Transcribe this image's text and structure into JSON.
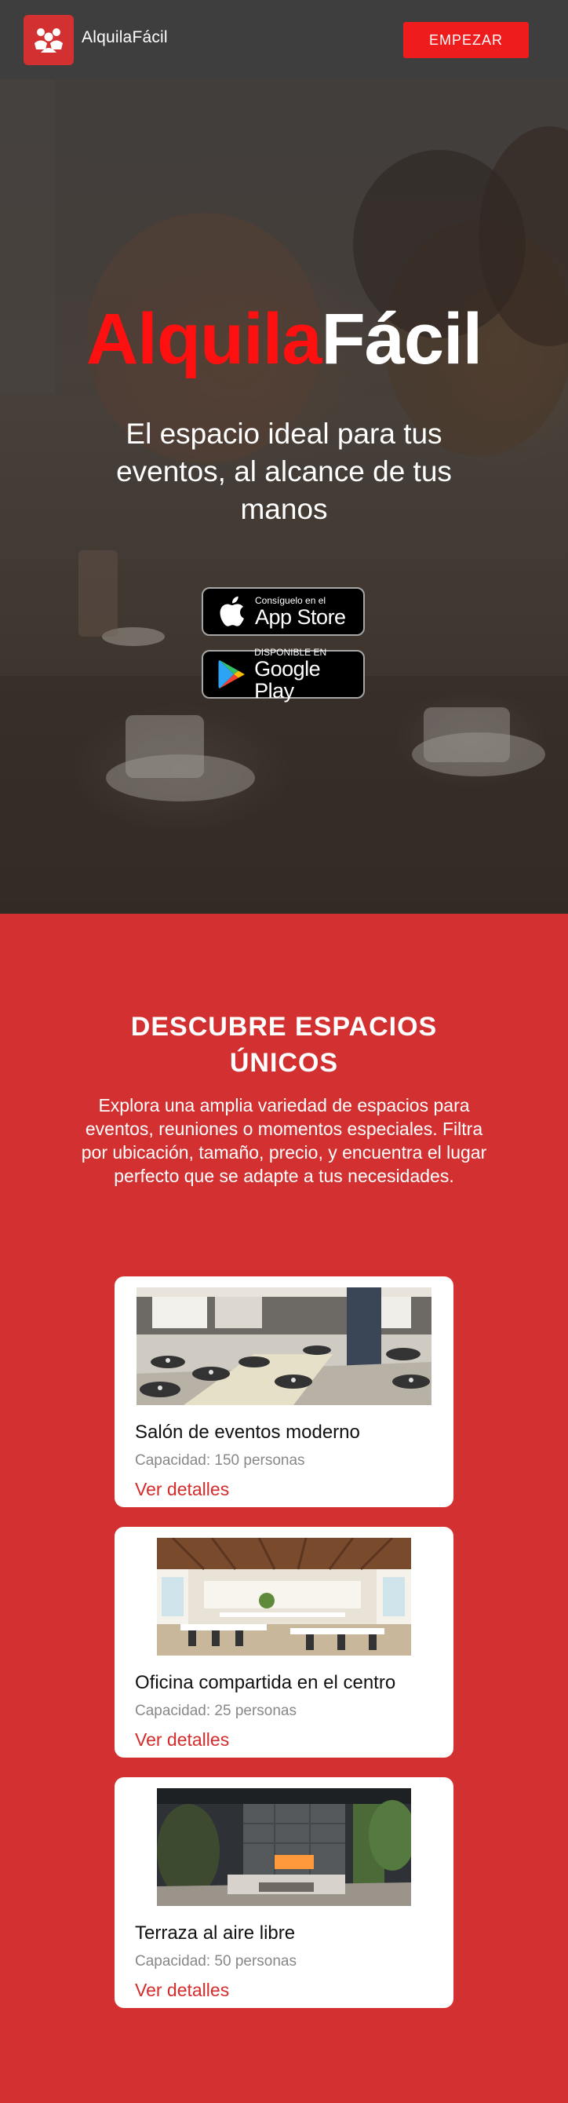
{
  "nav": {
    "brand": "AlquilaFácil",
    "cta_label": "EMPEZAR"
  },
  "hero": {
    "title_part1": "Alquila",
    "title_part2": "Fácil",
    "subtitle": "El espacio ideal para tus eventos, al alcance de tus manos",
    "app_store": {
      "small": "Consíguelo en el",
      "big": "App Store"
    },
    "google_play": {
      "small": "DISPONIBLE EN",
      "big": "Google Play"
    }
  },
  "section": {
    "title": "DESCUBRE ESPACIOS ÚNICOS",
    "description": "Explora una amplia variedad de espacios para eventos, reuniones o momentos especiales. Filtra por ubicación, tamaño, precio, y encuentra el lugar perfecto que se adapte a tus necesidades."
  },
  "cards": [
    {
      "name": "Salón de eventos moderno",
      "capacity": "Capacidad: 150 personas",
      "link": "Ver detalles"
    },
    {
      "name": "Oficina compartida en el centro",
      "capacity": "Capacidad: 25 personas",
      "link": "Ver detalles"
    },
    {
      "name": "Terraza al aire libre",
      "capacity": "Capacidad: 50 personas",
      "link": "Ver detalles"
    }
  ],
  "colors": {
    "primary_red": "#d33131",
    "cta_red": "#ee1c1c",
    "nav_dark": "#3e3e3e",
    "link_red": "#d62b2b"
  },
  "icons": {
    "logo": "people-group-icon",
    "app_store": "apple-icon",
    "google_play": "google-play-icon"
  }
}
